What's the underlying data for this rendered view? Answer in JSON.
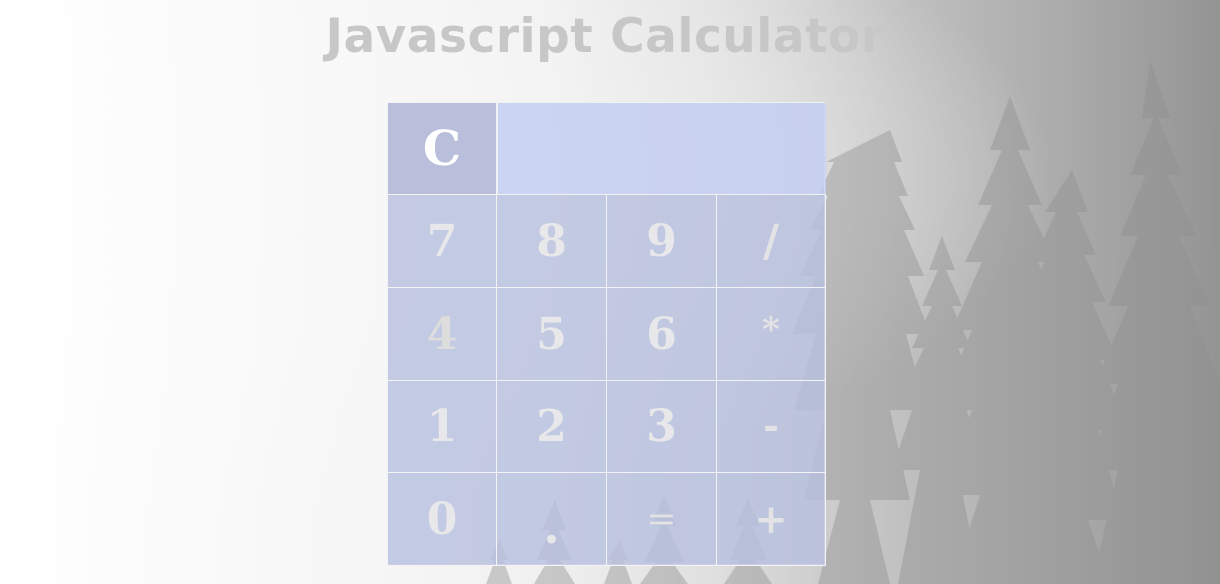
{
  "window": {
    "title": "Javascript Calculator"
  },
  "calculator": {
    "clear_label": "C",
    "display_value": "",
    "keys": [
      [
        "7",
        "8",
        "9",
        "/"
      ],
      [
        "4",
        "5",
        "6",
        "*"
      ],
      [
        "1",
        "2",
        "3",
        "-"
      ],
      [
        "0",
        ".",
        "=",
        "+"
      ]
    ]
  },
  "icons": {
    "background": "misty-forest-background"
  }
}
